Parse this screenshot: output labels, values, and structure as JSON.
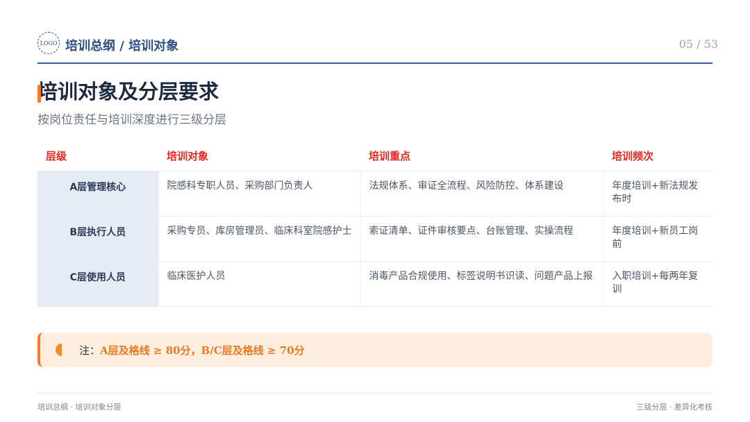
{
  "header": {
    "logo_text": "LOGO",
    "title": "培训总纲 / 培训对象",
    "page_number": "05 / 53"
  },
  "main": {
    "title": "培训对象及分层要求",
    "subtitle": "按岗位责任与培训深度进行三级分层"
  },
  "table": {
    "columns": [
      "层级",
      "培训对象",
      "培训重点",
      "培训频次"
    ],
    "rows": [
      {
        "level": "A层管理核心",
        "target": "院感科专职人员、采购部门负责人",
        "focus": "法规体系、审证全流程、风险防控、体系建设",
        "frequency": "年度培训+新法规发布时"
      },
      {
        "level": "B层执行人员",
        "target": "采购专员、库房管理员、临床科室院感护士",
        "focus": "索证清单、证件审核要点、台账管理、实操流程",
        "frequency": "年度培训+新员工岗前"
      },
      {
        "level": "C层使用人员",
        "target": "临床医护人员",
        "focus": "消毒产品合规使用、标签说明书识读、问题产品上报",
        "frequency": "入职培训+每两年复训"
      }
    ]
  },
  "note": {
    "label": "注：",
    "text": "A层及格线 ≥ 80分，B/C层及格线 ≥ 70分"
  },
  "footer": {
    "left": "培训总纲 · 培训对象分层",
    "right": "三级分层 · 差异化考核"
  },
  "colors": {
    "brand_blue": "#2f4f86",
    "accent_orange": "#ee7b2e",
    "header_red": "#e4261c",
    "level_bg": "#e6ecf6",
    "note_bg": "#fdeedf"
  }
}
